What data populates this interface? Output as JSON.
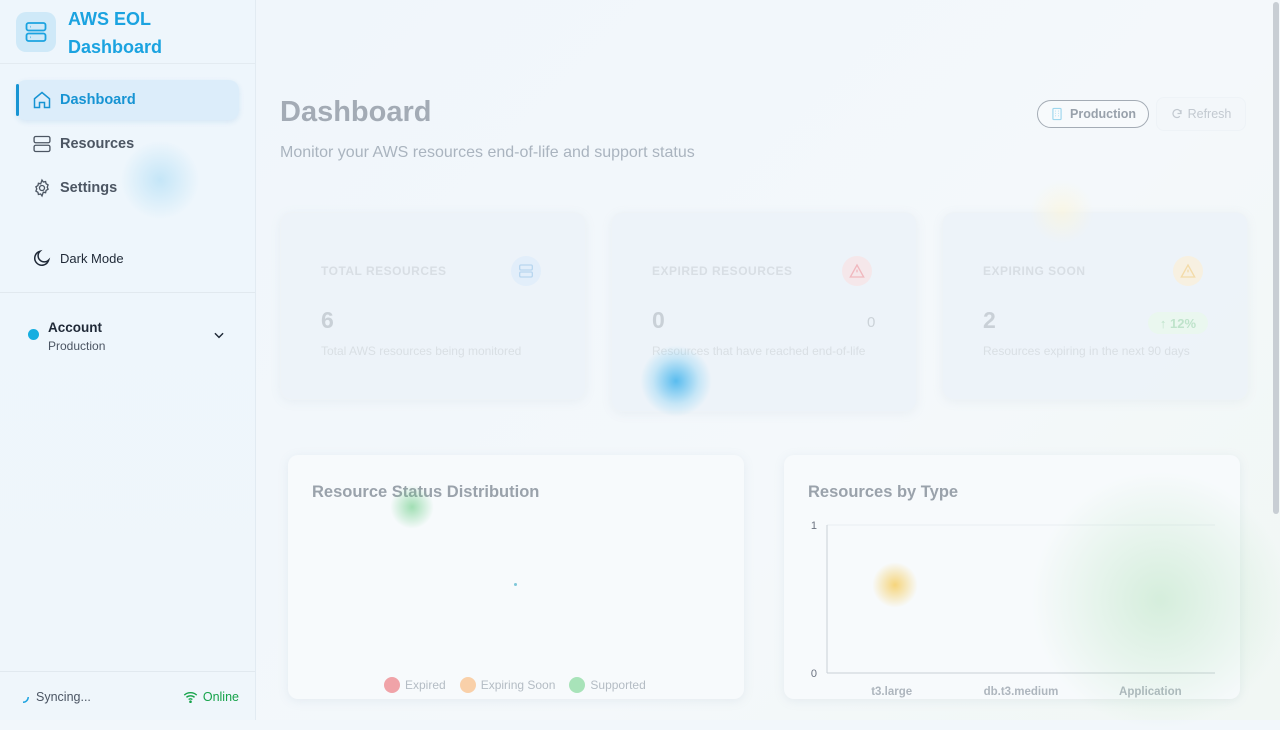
{
  "app": {
    "title": "AWS EOL Dashboard"
  },
  "sidebar": {
    "items": [
      {
        "label": "Dashboard",
        "icon": "home-icon",
        "active": true
      },
      {
        "label": "Resources",
        "icon": "server-icon",
        "active": false
      },
      {
        "label": "Settings",
        "icon": "gear-icon",
        "active": false
      }
    ],
    "dark_mode_label": "Dark Mode",
    "account": {
      "title": "Account",
      "value": "Production"
    },
    "status": {
      "sync_label": "Syncing...",
      "online_label": "Online"
    }
  },
  "header": {
    "title": "Dashboard",
    "subtitle": "Monitor your AWS resources end-of-life and support status",
    "environment_label": "Production",
    "refresh_label": "Refresh"
  },
  "stats": [
    {
      "label": "TOTAL RESOURCES",
      "value": "6",
      "description": "Total AWS resources being monitored",
      "icon": "server-icon",
      "accent": "#3b9fe0"
    },
    {
      "label": "EXPIRED RESOURCES",
      "value": "0",
      "side_value": "0",
      "description": "Resources that have reached end-of-life",
      "icon": "warning-triangle-icon",
      "accent": "#ef4444"
    },
    {
      "label": "EXPIRING SOON",
      "value": "2",
      "trend": "↑ 12%",
      "description": "Resources expiring in the next 90 days",
      "icon": "warning-triangle-icon",
      "accent": "#f59e0b"
    }
  ],
  "status_chart": {
    "title": "Resource Status Distribution",
    "legend": [
      {
        "label": "Expired",
        "color": "#f0a3a8"
      },
      {
        "label": "Expiring Soon",
        "color": "#f9d0a9"
      },
      {
        "label": "Supported",
        "color": "#a8e3b9"
      }
    ]
  },
  "chart_data": {
    "type": "bar",
    "title": "Resources by Type",
    "categories": [
      "t3.large",
      "db.t3.medium",
      "Application"
    ],
    "series": [],
    "y_ticks": [
      "0",
      "1"
    ],
    "ylim": [
      0,
      1
    ]
  }
}
